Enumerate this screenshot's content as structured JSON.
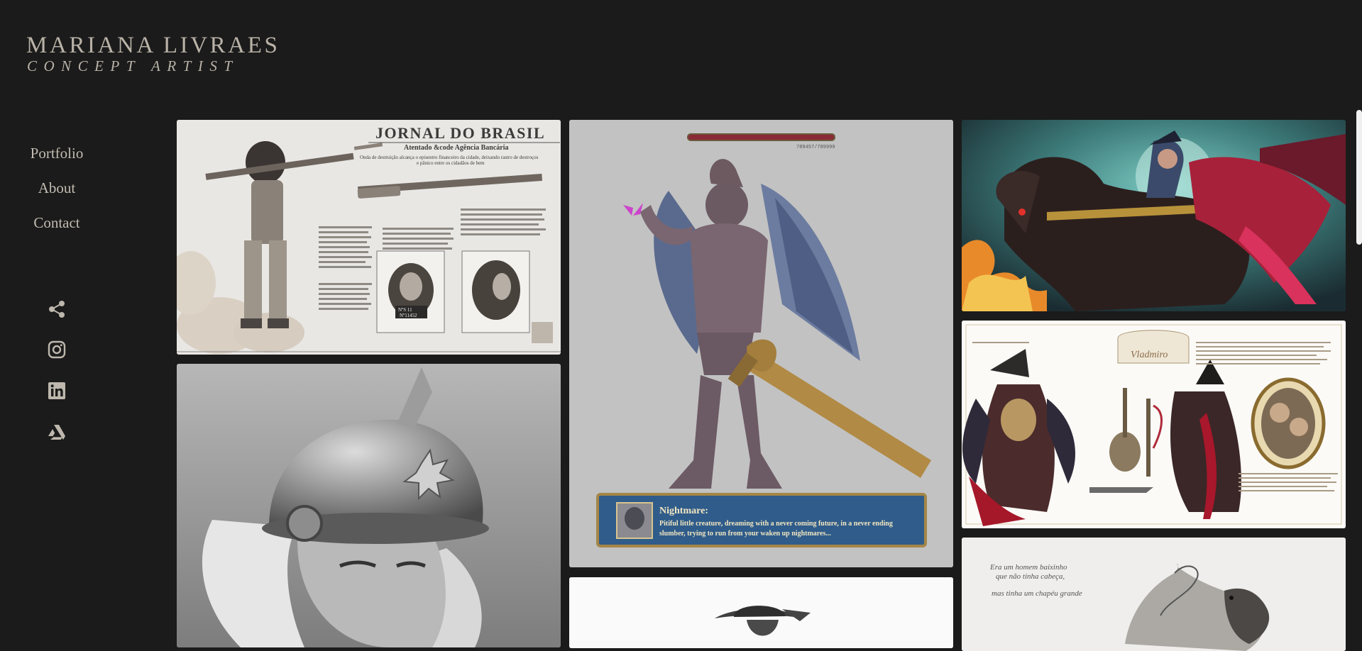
{
  "brand": {
    "name": "MARIANA LIVRAES",
    "tagline": "CONCEPT ARTIST"
  },
  "nav": {
    "items": [
      {
        "label": "Portfolio"
      },
      {
        "label": "About"
      },
      {
        "label": "Contact"
      }
    ]
  },
  "social": {
    "icons": [
      "share-icon",
      "instagram-icon",
      "linkedin-icon",
      "artstation-icon"
    ]
  },
  "colors": {
    "background": "#1b1b1b",
    "text": "#bdb7ad"
  },
  "gallery": {
    "journal": {
      "masthead": "JORNAL DO BRASIL",
      "headline": "Atentado &code Agência Bancária",
      "subheadline": "Onda de destruição alcança o episentro financeiro da cidade, deixando rastro de destroços e pânico entre os cidadãos de bem",
      "mugshot_plate": "NºS   11",
      "mugshot_number": "Nº11452"
    },
    "knight": {
      "hp": "789457/789999",
      "name": "Nightmare:",
      "line1": "Pitiful little creature, dreaming with a never coming future, in a never ending",
      "line2": "slumber, trying to run from your waken up nightmares..."
    },
    "character_sheet": {
      "title": "Vladmiro"
    },
    "sketch": {
      "line1": "Era um homem baixinho",
      "line2": "que não tinha cabeça,",
      "line3": "mas tinha um chapéu grande"
    }
  }
}
